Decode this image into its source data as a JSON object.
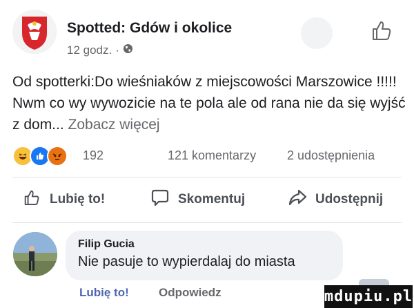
{
  "post": {
    "page_name": "Spotted: Gdów i okolice",
    "time": "12 godz.",
    "time_separator": "·",
    "privacy_icon": "globe-icon",
    "text": "Od spotterki:Do wieśniaków z miejscowości Marszowice !!!!! Nwm co wy wywozicie na te pola ale od rana nie da się wyjść z dom...",
    "see_more": "Zobacz więcej"
  },
  "stats": {
    "reactions_count": "192",
    "reaction_icons": [
      "haha-icon",
      "like-icon",
      "angry-icon"
    ],
    "comments": "121 komentarzy",
    "shares": "2 udostępnienia"
  },
  "actions": {
    "like": "Lubię to!",
    "comment": "Skomentuj",
    "share": "Udostępnij"
  },
  "comment": {
    "author": "Filip Gucia",
    "text": "Nie pasuje to wypierdalaj do miasta",
    "like": "Lubię to!",
    "reply": "Odpowiedz"
  },
  "watermark": "mdupiu.pl",
  "colors": {
    "like_blue": "#1877f2",
    "angry_orange": "#e9710f",
    "haha_yellow": "#f7c13c"
  }
}
